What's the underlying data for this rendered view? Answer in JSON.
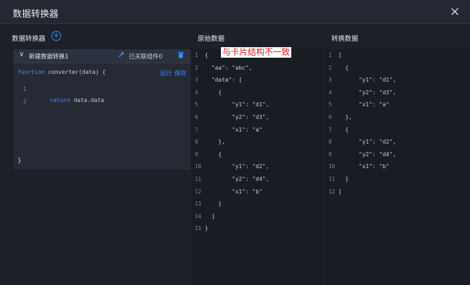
{
  "dialog": {
    "title": "数据转换器",
    "close_glyph": "×"
  },
  "overlay_text": "与卡片结构不一致",
  "left": {
    "heading": "数据转换器",
    "add_glyph": "+",
    "converter": {
      "chevron": "∨",
      "name": "新建数据转换1",
      "link_icon": "link-icon",
      "linked_label": "已关联组件0",
      "delete_icon": "trash-icon",
      "signature_kw": "function",
      "signature_rest": " converter(data) {",
      "run_label": "运行",
      "save_label": "保存",
      "line1": "1",
      "line2": "2",
      "return_kw": "return",
      "return_rest": " data.data",
      "closing": "}"
    }
  },
  "original": {
    "heading": "原始数据",
    "lines": [
      {
        "n": "1",
        "t": "{"
      },
      {
        "n": "2",
        "t": "  \"aa\": \"abc\","
      },
      {
        "n": "3",
        "t": "  \"data\": ["
      },
      {
        "n": "4",
        "t": "    {"
      },
      {
        "n": "5",
        "t": "        \"y1\": \"d1\","
      },
      {
        "n": "6",
        "t": "        \"y2\": \"d3\","
      },
      {
        "n": "7",
        "t": "        \"x1\": \"a\""
      },
      {
        "n": "8",
        "t": "    },"
      },
      {
        "n": "9",
        "t": "    {"
      },
      {
        "n": "10",
        "t": "        \"y1\": \"d2\","
      },
      {
        "n": "11",
        "t": "        \"y2\": \"d4\","
      },
      {
        "n": "12",
        "t": "        \"x1\": \"b\""
      },
      {
        "n": "13",
        "t": "    }"
      },
      {
        "n": "14",
        "t": "  ]"
      },
      {
        "n": "15",
        "t": "}"
      }
    ]
  },
  "converted": {
    "heading": "转换数据",
    "lines": [
      {
        "n": "1",
        "t": "["
      },
      {
        "n": "2",
        "t": "  {"
      },
      {
        "n": "3",
        "t": "      \"y1\": \"d1\","
      },
      {
        "n": "4",
        "t": "      \"y2\": \"d3\","
      },
      {
        "n": "5",
        "t": "      \"x1\": \"a\""
      },
      {
        "n": "6",
        "t": "  },"
      },
      {
        "n": "7",
        "t": "  {"
      },
      {
        "n": "8",
        "t": "      \"y1\": \"d2\","
      },
      {
        "n": "9",
        "t": "      \"y2\": \"d4\","
      },
      {
        "n": "10",
        "t": "      \"x1\": \"b\""
      },
      {
        "n": "11",
        "t": "  }"
      },
      {
        "n": "12",
        "t": "]"
      }
    ]
  }
}
